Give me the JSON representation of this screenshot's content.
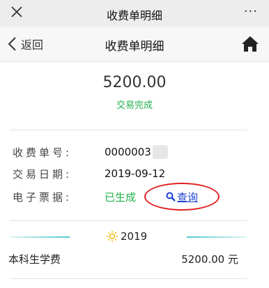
{
  "window": {
    "title": "收费单明细",
    "close_icon": "close-icon",
    "more_label": "···"
  },
  "nav": {
    "back_label": "返回",
    "title": "收费单明细",
    "home_icon": "home-icon"
  },
  "summary": {
    "amount": "5200.00",
    "status": "交易完成",
    "status_color": "#23b14d"
  },
  "details": [
    {
      "label": "收费单号:",
      "value": "0000003"
    },
    {
      "label": "交易日期:",
      "value": "2019-09-12"
    },
    {
      "label": "电子票据:",
      "value": "已生成"
    }
  ],
  "query": {
    "label": "查询",
    "icon": "search-icon",
    "highlight_color": "#e02020"
  },
  "year_section": {
    "year": "2019",
    "icon": "sun-icon"
  },
  "fee_items": [
    {
      "name": "本科生学费",
      "amount": "5200.00 元"
    }
  ]
}
